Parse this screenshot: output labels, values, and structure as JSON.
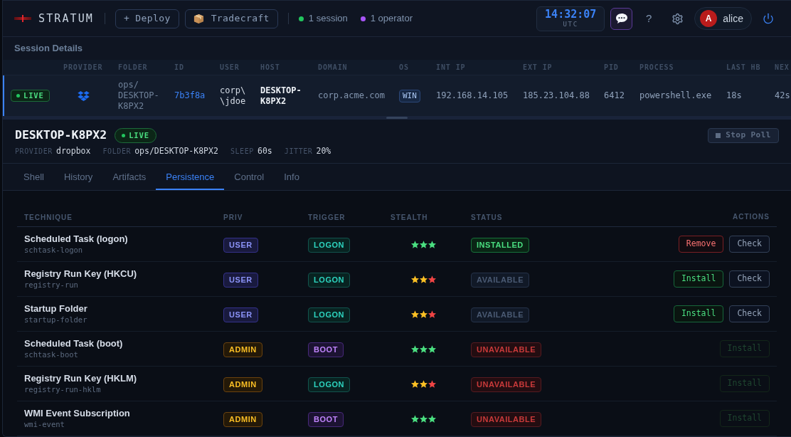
{
  "topbar": {
    "brand": "STRATUM",
    "buttons": [
      {
        "label": "+ Deploy",
        "kind": "plain"
      },
      {
        "label": "Tradecraft",
        "kind": "package"
      }
    ],
    "stats": [
      {
        "label": "1 session",
        "color": "#22c55e"
      },
      {
        "label": "1 operator",
        "color": "#a855f7"
      }
    ],
    "clock": {
      "time": "14:32:07",
      "zone": "UTC"
    },
    "help": "?",
    "user": {
      "initial": "A",
      "name": "alice"
    }
  },
  "sessions": {
    "title": "Session Details",
    "columns": [
      "PROVIDER",
      "FOLDER",
      "ID",
      "USER",
      "HOST",
      "DOMAIN",
      "OS",
      "INT IP",
      "EXT IP",
      "PID",
      "PROCESS",
      "LAST HB",
      "NEX"
    ],
    "rows": [
      {
        "selected": true,
        "status": {
          "label": "LIVE",
          "kind": "live"
        },
        "folder": "ops/DESKTOP-K8PX2",
        "id": "7b3f8a",
        "user": "corp\\\\jdoe",
        "host": "DESKTOP-K8PX2",
        "domain": "corp.acme.com",
        "os": "WIN",
        "int_ip": "192.168.14.105",
        "ext_ip": "185.23.104.88",
        "pid": "6412",
        "process": "powershell.exe",
        "last_hb": "18s",
        "column_14": "42s"
      }
    ]
  },
  "detail": {
    "host": "DESKTOP-K8PX2",
    "status": {
      "label": "LIVE",
      "kind": "live"
    },
    "meta": [
      {
        "label": "PROVIDER",
        "value": "dropbox"
      },
      {
        "label": "FOLDER",
        "value": "ops/DESKTOP-K8PX2"
      },
      {
        "label": "SLEEP",
        "value": "60s"
      },
      {
        "label": "JITTER",
        "value": "20%"
      }
    ],
    "stop_button": "Stop Poll"
  },
  "tabs": [
    {
      "label": "Shell",
      "selected": false
    },
    {
      "label": "History",
      "selected": false
    },
    {
      "label": "Artifacts",
      "selected": false
    },
    {
      "label": "Persistence",
      "selected": true
    },
    {
      "label": "Control",
      "selected": false
    },
    {
      "label": "Info",
      "selected": false
    }
  ],
  "persistence": {
    "columns": [
      "TECHNIQUE",
      "PRIV",
      "TRIGGER",
      "STEALTH",
      "STATUS",
      "ACTIONS"
    ],
    "rows": [
      {
        "name": "Scheduled Task (logon)",
        "slug": "schtask-logon",
        "priv": {
          "label": "USER",
          "kind": "user"
        },
        "trigger": {
          "label": "LOGON",
          "kind": "logon"
        },
        "stars": 3,
        "status": {
          "label": "INSTALLED",
          "kind": "installed"
        },
        "actions": [
          {
            "label": "Remove",
            "kind": "remove",
            "disabled": false
          },
          {
            "label": "Check",
            "kind": "check",
            "disabled": false
          }
        ]
      },
      {
        "name": "Registry Run Key (HKCU)",
        "slug": "registry-run",
        "priv": {
          "label": "USER",
          "kind": "user"
        },
        "trigger": {
          "label": "LOGON",
          "kind": "logon"
        },
        "stars": 2,
        "status": {
          "label": "AVAILABLE",
          "kind": "available"
        },
        "actions": [
          {
            "label": "Install",
            "kind": "install",
            "disabled": false
          },
          {
            "label": "Check",
            "kind": "check",
            "disabled": false
          }
        ]
      },
      {
        "name": "Startup Folder",
        "slug": "startup-folder",
        "priv": {
          "label": "USER",
          "kind": "user"
        },
        "trigger": {
          "label": "LOGON",
          "kind": "logon"
        },
        "stars": 2,
        "status": {
          "label": "AVAILABLE",
          "kind": "available"
        },
        "actions": [
          {
            "label": "Install",
            "kind": "install",
            "disabled": false
          },
          {
            "label": "Check",
            "kind": "check",
            "disabled": false
          }
        ]
      },
      {
        "name": "Scheduled Task (boot)",
        "slug": "schtask-boot",
        "priv": {
          "label": "ADMIN",
          "kind": "admin"
        },
        "trigger": {
          "label": "BOOT",
          "kind": "boot"
        },
        "stars": 3,
        "status": {
          "label": "UNAVAILABLE",
          "kind": "unavailable"
        },
        "actions": [
          {
            "label": "Install",
            "kind": "install",
            "disabled": true
          }
        ]
      },
      {
        "name": "Registry Run Key (HKLM)",
        "slug": "registry-run-hklm",
        "priv": {
          "label": "ADMIN",
          "kind": "admin"
        },
        "trigger": {
          "label": "LOGON",
          "kind": "logon"
        },
        "stars": 2,
        "status": {
          "label": "UNAVAILABLE",
          "kind": "unavailable"
        },
        "actions": [
          {
            "label": "Install",
            "kind": "install",
            "disabled": true
          }
        ]
      },
      {
        "name": "WMI Event Subscription",
        "slug": "wmi-event",
        "priv": {
          "label": "ADMIN",
          "kind": "admin"
        },
        "trigger": {
          "label": "BOOT",
          "kind": "boot"
        },
        "stars": 3,
        "status": {
          "label": "UNAVAILABLE",
          "kind": "unavailable"
        },
        "actions": [
          {
            "label": "Install",
            "kind": "install",
            "disabled": true
          }
        ]
      }
    ]
  }
}
